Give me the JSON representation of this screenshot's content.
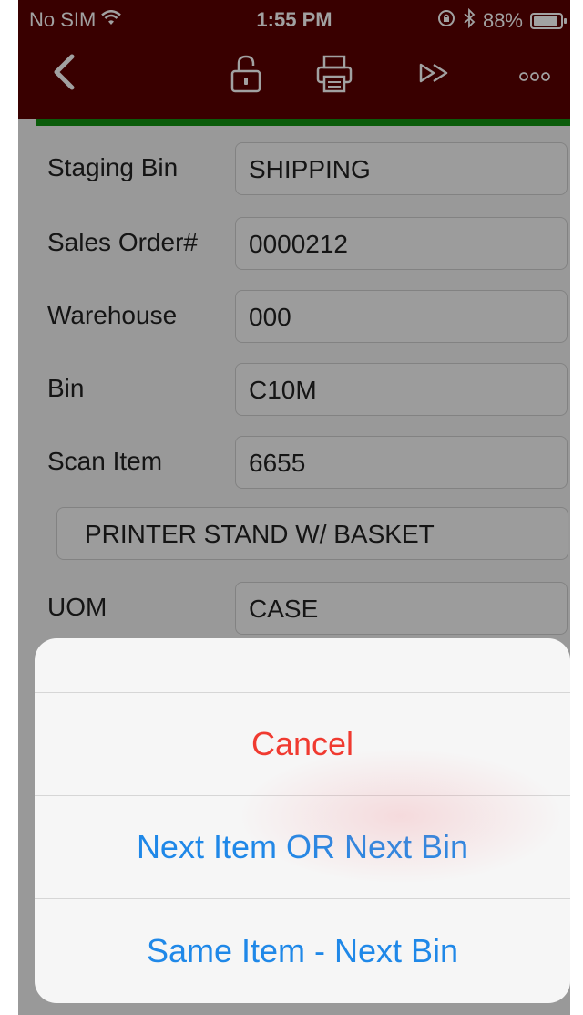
{
  "status_bar": {
    "carrier": "No SIM",
    "time": "1:55 PM",
    "battery_pct": "88%"
  },
  "nav": {
    "back_icon": "chevron-left-icon",
    "lock_icon": "unlock-icon",
    "print_icon": "printer-icon",
    "forward_icon": "fast-forward-icon",
    "more_icon": "more-icon"
  },
  "form": {
    "staging_bin": {
      "label": "Staging Bin",
      "value": "SHIPPING"
    },
    "sales_order": {
      "label": "Sales Order#",
      "value": "0000212"
    },
    "warehouse": {
      "label": "Warehouse",
      "value": "000"
    },
    "bin": {
      "label": "Bin",
      "value": "C10M"
    },
    "scan_item": {
      "label": "Scan Item",
      "value": "6655"
    },
    "description": "PRINTER STAND W/ BASKET",
    "uom": {
      "label": "UOM",
      "value": "CASE"
    }
  },
  "action_sheet": {
    "cancel": "Cancel",
    "next_item": "Next Item OR Next Bin",
    "same_item": "Same Item - Next Bin"
  },
  "colors": {
    "nav_background": "#5b0000",
    "accent_green": "#129212",
    "cancel_red": "#f03a30",
    "action_blue": "#1f88e8"
  }
}
